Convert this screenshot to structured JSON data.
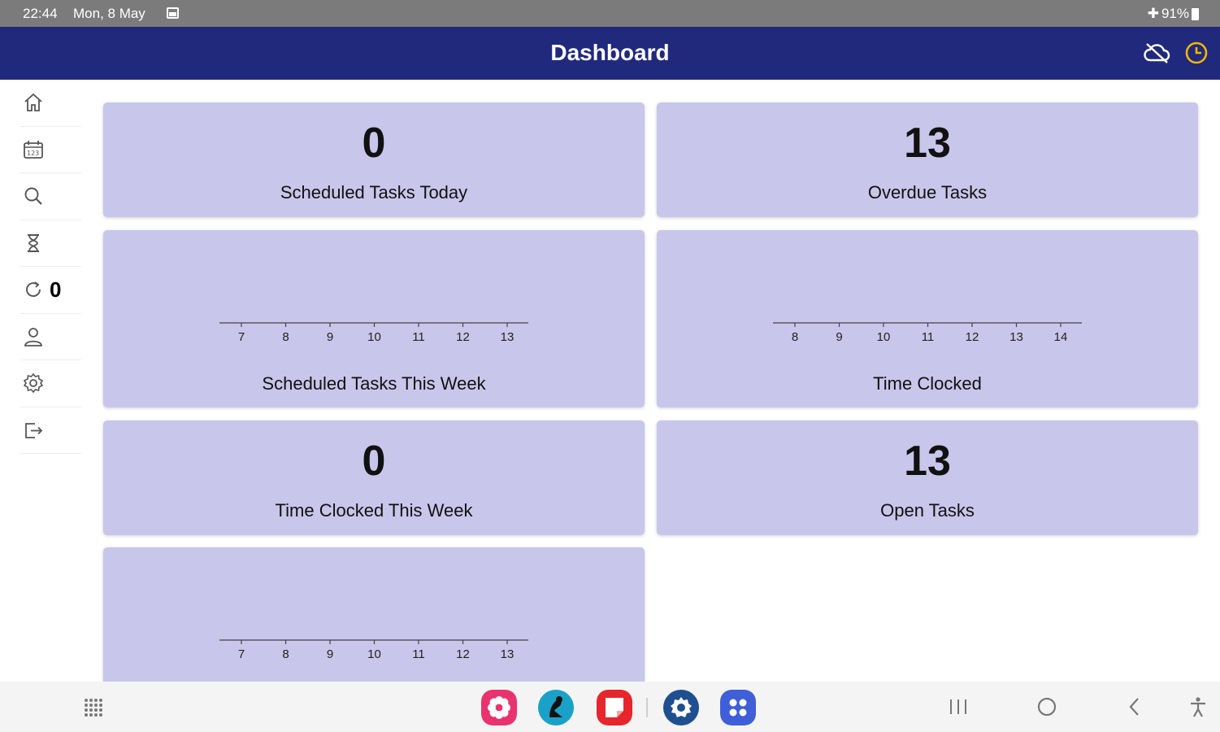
{
  "status_bar": {
    "time": "22:44",
    "date": "Mon, 8 May",
    "battery": "91%"
  },
  "app_bar": {
    "title": "Dashboard",
    "accent": "#21297d",
    "clock_color": "#f2b705"
  },
  "sidebar": {
    "items": [
      {
        "icon": "home-icon"
      },
      {
        "icon": "calendar-icon"
      },
      {
        "icon": "search-icon"
      },
      {
        "icon": "hourglass-icon"
      },
      {
        "icon": "sync-icon",
        "count": "0"
      },
      {
        "icon": "user-icon"
      },
      {
        "icon": "settings-icon"
      },
      {
        "icon": "logout-icon"
      }
    ]
  },
  "cards": {
    "scheduled_today": {
      "value": "0",
      "label": "Scheduled Tasks Today"
    },
    "overdue": {
      "value": "13",
      "label": "Overdue Tasks"
    },
    "scheduled_week": {
      "label": "Scheduled Tasks This Week",
      "ticks": [
        "7",
        "8",
        "9",
        "10",
        "11",
        "12",
        "13"
      ]
    },
    "time_clocked": {
      "label": "Time Clocked",
      "ticks": [
        "8",
        "9",
        "10",
        "11",
        "12",
        "13",
        "14"
      ]
    },
    "time_clocked_week": {
      "value": "0",
      "label": "Time Clocked This Week"
    },
    "open_tasks": {
      "value": "13",
      "label": "Open Tasks"
    },
    "bottom_chart": {
      "ticks": [
        "7",
        "8",
        "9",
        "10",
        "11",
        "12",
        "13"
      ]
    }
  },
  "chart_data": [
    {
      "type": "bar",
      "title": "Scheduled Tasks This Week",
      "categories": [
        "7",
        "8",
        "9",
        "10",
        "11",
        "12",
        "13"
      ],
      "values": []
    },
    {
      "type": "bar",
      "title": "Time Clocked",
      "categories": [
        "8",
        "9",
        "10",
        "11",
        "12",
        "13",
        "14"
      ],
      "values": []
    },
    {
      "type": "bar",
      "categories": [
        "7",
        "8",
        "9",
        "10",
        "11",
        "12",
        "13"
      ],
      "values": []
    }
  ],
  "dock": {
    "apps": [
      {
        "icon": "flower-app-icon",
        "color": "#e8336f"
      },
      {
        "icon": "reader-app-icon",
        "color": "#1aa1c7"
      },
      {
        "icon": "notes-app-icon",
        "color": "#e6262c"
      },
      {
        "icon": "settings-app-icon",
        "color": "#1f4f8f"
      },
      {
        "icon": "apps-app-icon",
        "color": "#3f5fd8"
      }
    ]
  }
}
